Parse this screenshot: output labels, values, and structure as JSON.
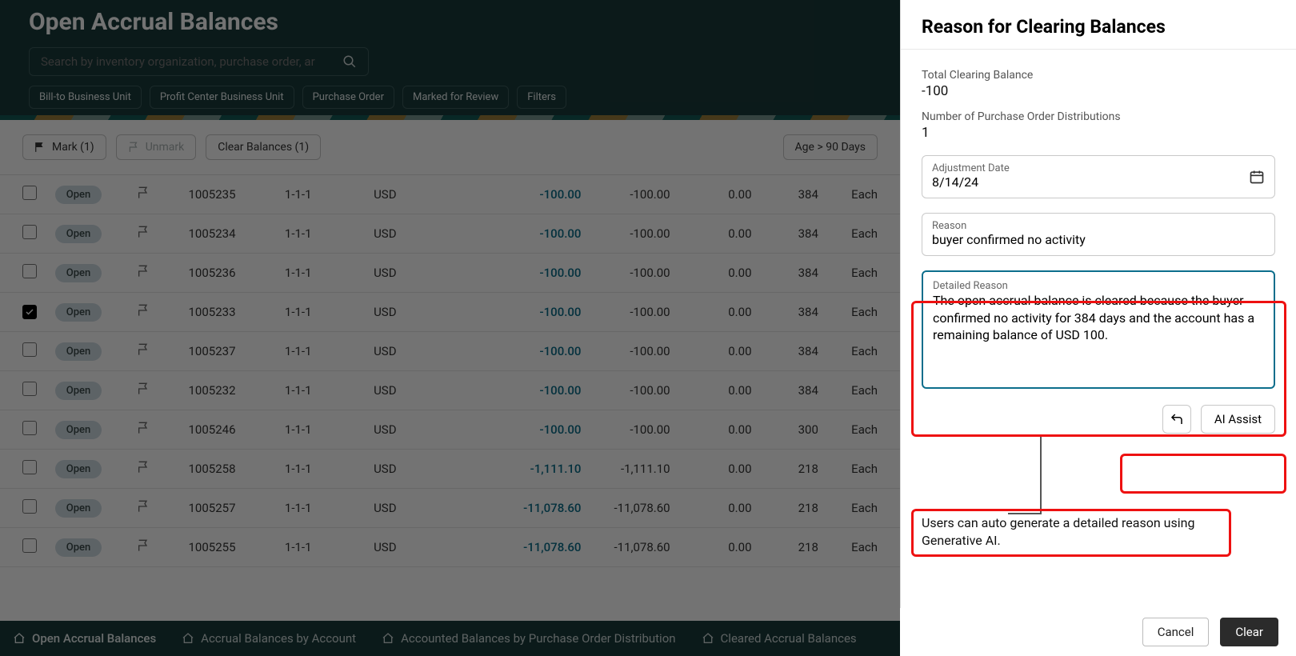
{
  "page": {
    "title": "Open Accrual Balances",
    "search_placeholder": "Search by inventory organization, purchase order, ar"
  },
  "filter_chips": [
    "Bill-to Business Unit",
    "Profit Center Business Unit",
    "Purchase Order",
    "Marked for Review",
    "Filters"
  ],
  "toolbar": {
    "mark": "Mark (1)",
    "unmark": "Unmark",
    "clear": "Clear Balances (1)",
    "age_filter": "Age > 90 Days"
  },
  "rows": [
    {
      "checked": false,
      "status": "Open",
      "doc": "1005235",
      "lines": "1-1-1",
      "cur": "USD",
      "amt1": "-100.00",
      "amt2": "-100.00",
      "zero": "0.00",
      "age": "384",
      "unit": "Each"
    },
    {
      "checked": false,
      "status": "Open",
      "doc": "1005234",
      "lines": "1-1-1",
      "cur": "USD",
      "amt1": "-100.00",
      "amt2": "-100.00",
      "zero": "0.00",
      "age": "384",
      "unit": "Each"
    },
    {
      "checked": false,
      "status": "Open",
      "doc": "1005236",
      "lines": "1-1-1",
      "cur": "USD",
      "amt1": "-100.00",
      "amt2": "-100.00",
      "zero": "0.00",
      "age": "384",
      "unit": "Each"
    },
    {
      "checked": true,
      "status": "Open",
      "doc": "1005233",
      "lines": "1-1-1",
      "cur": "USD",
      "amt1": "-100.00",
      "amt2": "-100.00",
      "zero": "0.00",
      "age": "384",
      "unit": "Each"
    },
    {
      "checked": false,
      "status": "Open",
      "doc": "1005237",
      "lines": "1-1-1",
      "cur": "USD",
      "amt1": "-100.00",
      "amt2": "-100.00",
      "zero": "0.00",
      "age": "384",
      "unit": "Each"
    },
    {
      "checked": false,
      "status": "Open",
      "doc": "1005232",
      "lines": "1-1-1",
      "cur": "USD",
      "amt1": "-100.00",
      "amt2": "-100.00",
      "zero": "0.00",
      "age": "384",
      "unit": "Each"
    },
    {
      "checked": false,
      "status": "Open",
      "doc": "1005246",
      "lines": "1-1-1",
      "cur": "USD",
      "amt1": "-100.00",
      "amt2": "-100.00",
      "zero": "0.00",
      "age": "300",
      "unit": "Each"
    },
    {
      "checked": false,
      "status": "Open",
      "doc": "1005258",
      "lines": "1-1-1",
      "cur": "USD",
      "amt1": "-1,111.10",
      "amt2": "-1,111.10",
      "zero": "0.00",
      "age": "218",
      "unit": "Each"
    },
    {
      "checked": false,
      "status": "Open",
      "doc": "1005257",
      "lines": "1-1-1",
      "cur": "USD",
      "amt1": "-11,078.60",
      "amt2": "-11,078.60",
      "zero": "0.00",
      "age": "218",
      "unit": "Each"
    },
    {
      "checked": false,
      "status": "Open",
      "doc": "1005255",
      "lines": "1-1-1",
      "cur": "USD",
      "amt1": "-11,078.60",
      "amt2": "-11,078.60",
      "zero": "0.00",
      "age": "218",
      "unit": "Each"
    }
  ],
  "bottom_tabs": [
    "Open Accrual Balances",
    "Accrual Balances by Account",
    "Accounted Balances by Purchase Order Distribution",
    "Cleared Accrual Balances"
  ],
  "drawer": {
    "title": "Reason for Clearing Balances",
    "total_label": "Total Clearing Balance",
    "total_value": "-100",
    "count_label": "Number of Purchase Order Distributions",
    "count_value": "1",
    "date_label": "Adjustment Date",
    "date_value": "8/14/24",
    "reason_label": "Reason",
    "reason_value": "buyer confirmed no activity",
    "detailed_label": "Detailed Reason",
    "detailed_value": "The open accrual balance is cleared because the buyer confirmed no activity for 384 days and the account has a remaining balance of USD 100.",
    "ai_assist": "AI Assist",
    "callout": "Users can auto generate a detailed reason using Generative AI.",
    "cancel": "Cancel",
    "clear": "Clear"
  }
}
